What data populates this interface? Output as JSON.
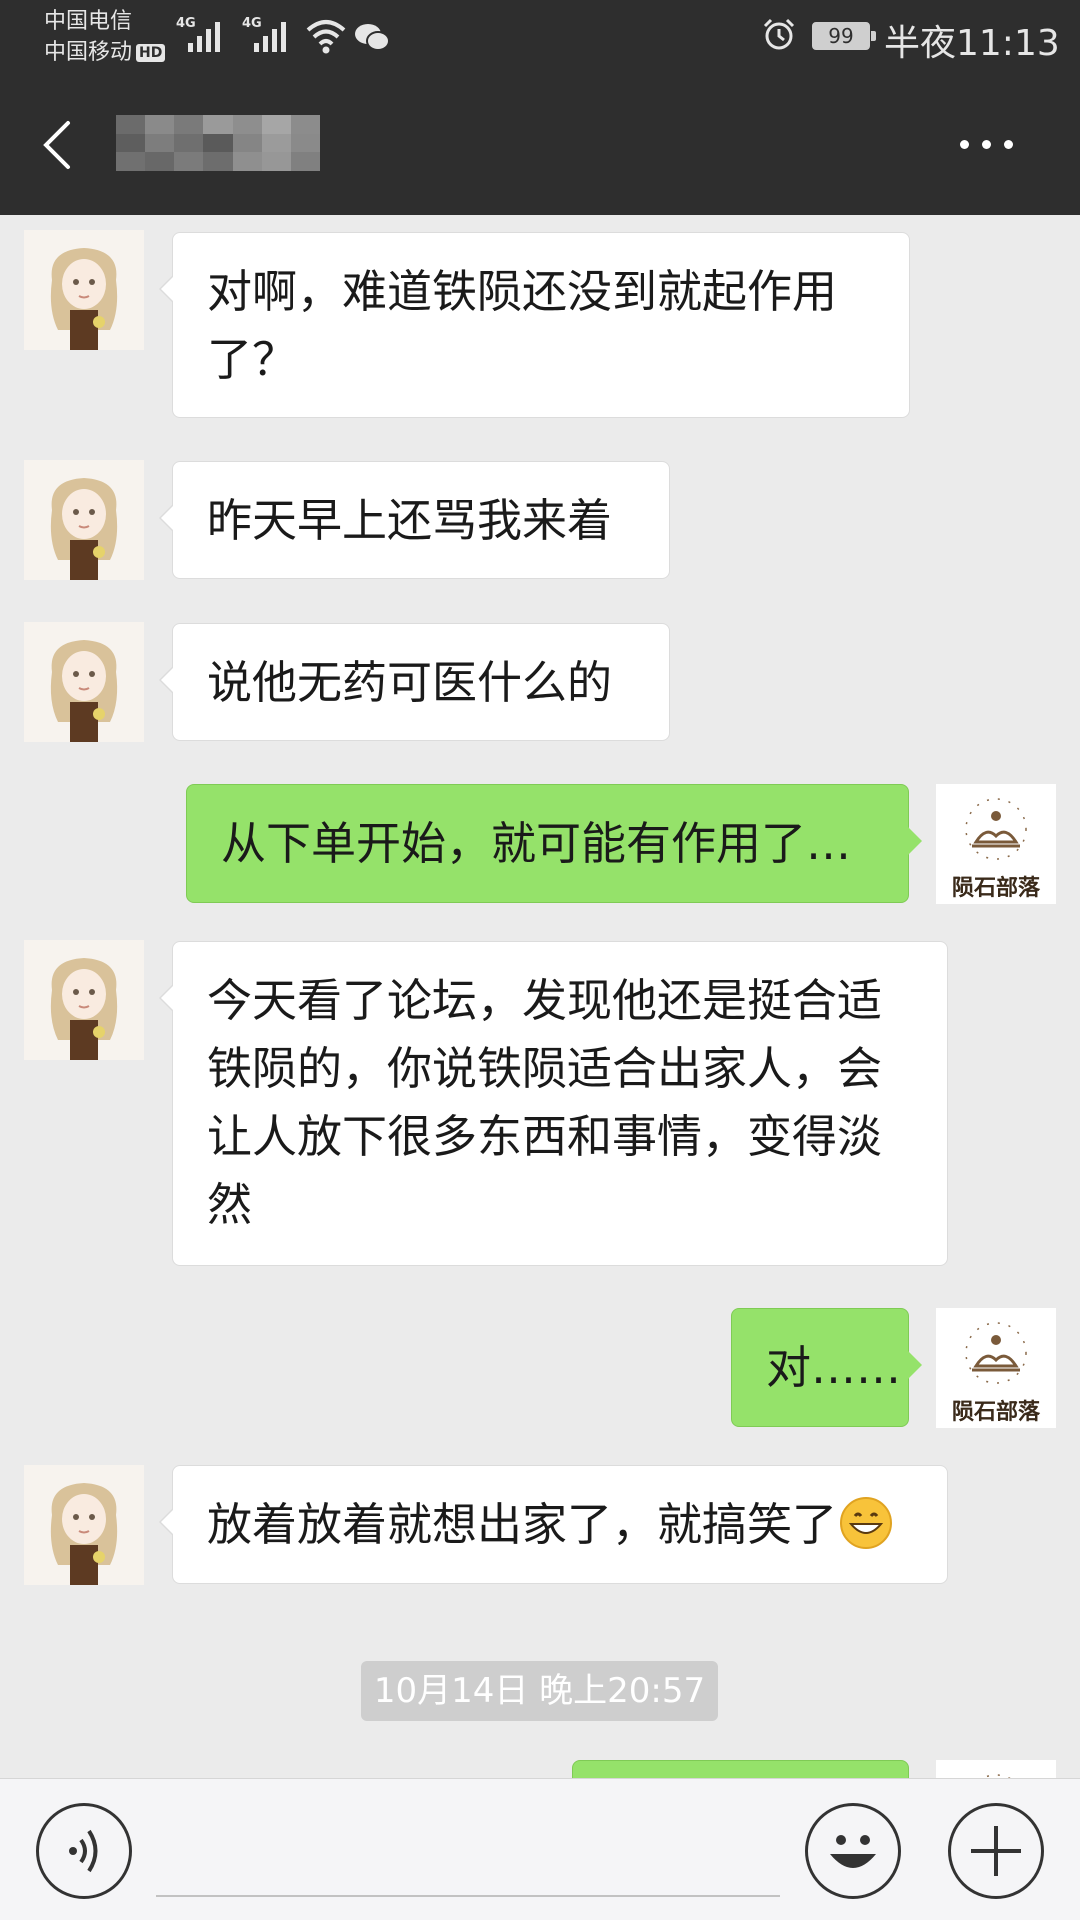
{
  "status_bar": {
    "carrier_1": "中国电信",
    "carrier_2": "中国移动",
    "hd_badge": "HD",
    "network_1": "4G",
    "network_2": "4G",
    "battery": "99",
    "time": "半夜11:13",
    "icons": [
      "signal-icon",
      "wifi-icon",
      "wechat-icon",
      "alarm-icon",
      "battery-icon"
    ]
  },
  "header": {
    "back_icon": "chevron-left-icon",
    "more_icon": "more-dots-icon"
  },
  "avatars": {
    "other_user": "girl-avatar",
    "self_label": "陨石部落"
  },
  "messages": [
    {
      "side": "left",
      "text": "对啊，难道铁陨还没到就起作用了？"
    },
    {
      "side": "left",
      "text": "昨天早上还骂我来着"
    },
    {
      "side": "left",
      "text": "说他无药可医什么的"
    },
    {
      "side": "right",
      "text": "从下单开始，就可能有作用了…"
    },
    {
      "side": "left",
      "text": "今天看了论坛，发现他还是挺合适铁陨的，你说铁陨适合出家人，会让人放下很多东西和事情，变得淡然"
    },
    {
      "side": "right",
      "text": "对……"
    },
    {
      "side": "left",
      "text": "放着放着就想出家了，就搞笑了",
      "emoji": "grinning-face-emoji"
    },
    {
      "side": "right",
      "text": ""
    }
  ],
  "timestamp": "10月14日 晚上20:57",
  "input_bar": {
    "voice_icon": "voice-icon",
    "emoji_icon": "emoji-icon",
    "plus_icon": "plus-icon",
    "text_value": ""
  },
  "colors": {
    "bar_background": "#2e2e2e",
    "chat_background": "#ebebeb",
    "sent_bubble": "#95e26a",
    "received_bubble": "#ffffff"
  }
}
